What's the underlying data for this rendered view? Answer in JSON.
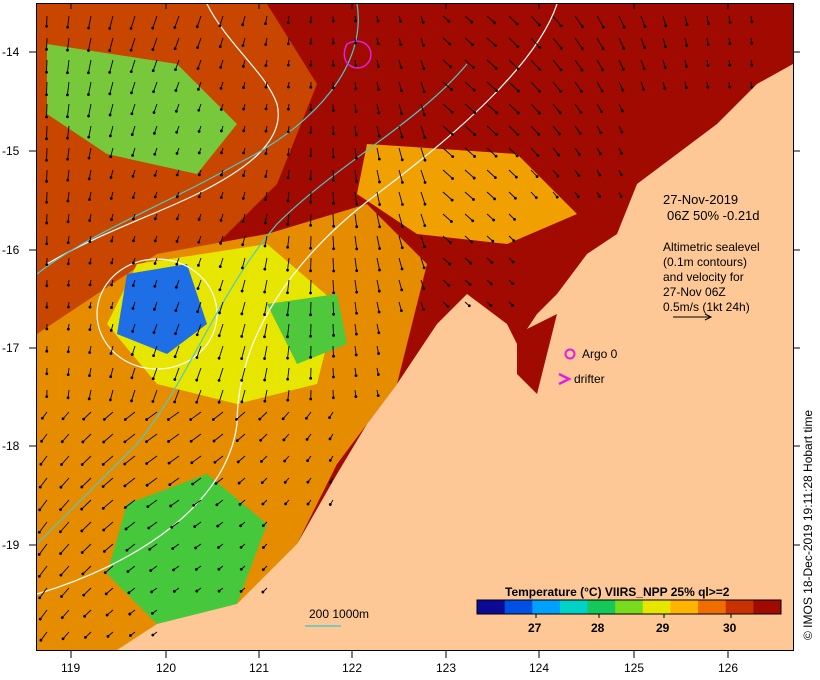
{
  "date_label": "27-Nov-2019",
  "time_label": "06Z  50% -0.21d",
  "altimetry_note": [
    "Altimetric sealevel",
    "(0.1m contours)",
    "and velocity for",
    "27-Nov 06Z",
    "0.5m/s (1kt 24h)"
  ],
  "argo_label": "Argo 0",
  "drifter_label": "drifter",
  "colorbar": {
    "title": "Temperature (°C) VIIRS_NPP 25% ql>=2",
    "ticks": [
      "27",
      "28",
      "29",
      "30"
    ],
    "colors": [
      "#0a0a96",
      "#0050e6",
      "#00a0ff",
      "#00d2c8",
      "#14c85a",
      "#78dc1e",
      "#e6e600",
      "#ffb400",
      "#f06e00",
      "#c83200",
      "#a00a00"
    ]
  },
  "bathy_legend": "200  1000m",
  "credit": "© IMOS 18-Dec-2019 19:11:28 Hobart time",
  "x_ticks": [
    "119",
    "120",
    "121",
    "122",
    "123",
    "124",
    "125",
    "126"
  ],
  "y_ticks": [
    "-14",
    "-15",
    "-16",
    "-17",
    "-18",
    "-19"
  ],
  "colors": {
    "land": "#fdc896",
    "warm": "#a00a00",
    "argo": "#e020e0",
    "contour": "#50c8c8"
  }
}
